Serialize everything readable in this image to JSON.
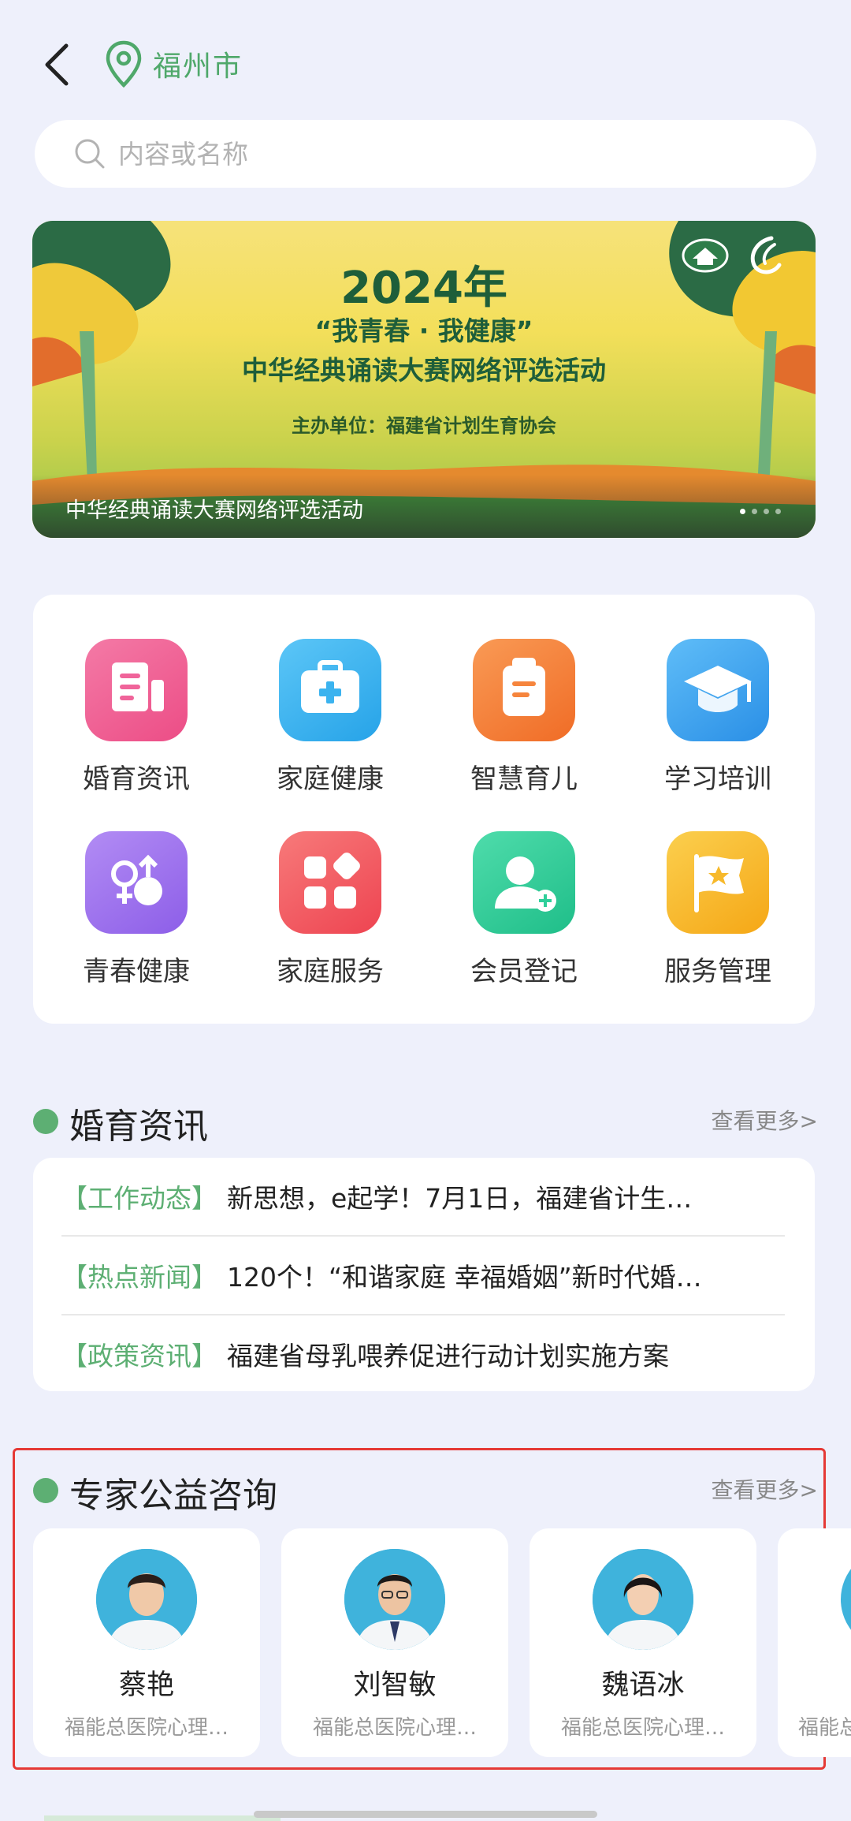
{
  "header": {
    "location": "福州市"
  },
  "search": {
    "placeholder": "内容或名称"
  },
  "banner": {
    "year": "2024年",
    "line1": "“我青春 · 我健康”",
    "line2": "中华经典诵读大赛网络评选活动",
    "host": "主办单位：福建省计划生育协会",
    "caption": "中华经典诵读大赛网络评选活动"
  },
  "grid": [
    {
      "label": "婚育资讯",
      "icon": "document-icon",
      "color": "#f0649a"
    },
    {
      "label": "家庭健康",
      "icon": "medical-kit-icon",
      "color": "#3bb3ef"
    },
    {
      "label": "智慧育儿",
      "icon": "clipboard-icon",
      "color": "#f6853d"
    },
    {
      "label": "学习培训",
      "icon": "graduation-cap-icon",
      "color": "#3aa7f1"
    },
    {
      "label": "青春健康",
      "icon": "gender-icon",
      "color": "#a274ee"
    },
    {
      "label": "家庭服务",
      "icon": "blocks-icon",
      "color": "#f2575c"
    },
    {
      "label": "会员登记",
      "icon": "add-user-icon",
      "color": "#2fcf9a"
    },
    {
      "label": "服务管理",
      "icon": "flag-star-icon",
      "color": "#f7b92b"
    }
  ],
  "news_section": {
    "title": "婚育资讯",
    "more": "查看更多>",
    "items": [
      {
        "tag": "【工作动态】",
        "title": "新思想，e起学！7月1日，福建省计生…"
      },
      {
        "tag": "【热点新闻】",
        "title": "120个！“和谐家庭 幸福婚姻”新时代婚…"
      },
      {
        "tag": "【政策资讯】",
        "title": "福建省母乳喂养促进行动计划实施方案"
      }
    ]
  },
  "expert_section": {
    "title": "专家公益咨询",
    "more": "查看更多>",
    "experts": [
      {
        "name": "蔡艳",
        "org": "福能总医院心理…"
      },
      {
        "name": "刘智敏",
        "org": "福能总医院心理…"
      },
      {
        "name": "魏语冰",
        "org": "福能总医院心理…"
      },
      {
        "name": "",
        "org": "福能总"
      }
    ]
  },
  "colors": {
    "accent": "#5daf73",
    "highlight": "#e53935"
  }
}
